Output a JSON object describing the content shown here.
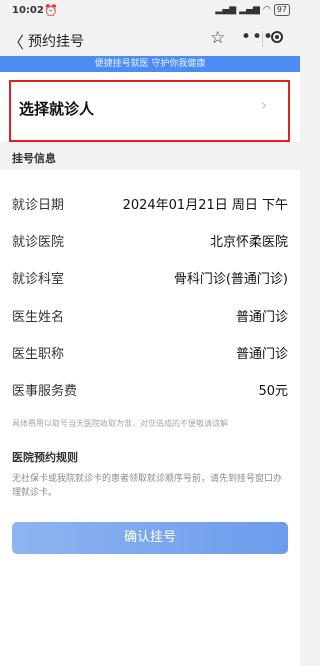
{
  "status_bar": {
    "time": "10:02",
    "alarm_icon": "alarm-clock-icon",
    "battery": "97"
  },
  "nav": {
    "title": "预约挂号",
    "back_icon": "back-arrow-icon",
    "star_icon": "star-icon",
    "more_icon": "more-dots-icon",
    "record_icon": "record-icon"
  },
  "banner": {
    "text": "便捷挂号就医 守护你我健康"
  },
  "patient": {
    "label": "选择就诊人",
    "chevron": "›"
  },
  "registration": {
    "section_title": "挂号信息",
    "rows": [
      {
        "key": "就诊日期",
        "value": "2024年01月21日 周日 下午"
      },
      {
        "key": "就诊医院",
        "value": "北京怀柔医院"
      },
      {
        "key": "就诊科室",
        "value": "骨科门诊(普通门诊)"
      },
      {
        "key": "医生姓名",
        "value": "普通门诊"
      },
      {
        "key": "医生职称",
        "value": "普通门诊"
      },
      {
        "key": "医事服务费",
        "value": "50元"
      }
    ],
    "fee_note": "具体费用以取号当天医院收取为准，对您造成的不便敬请谅解"
  },
  "rules": {
    "title": "医院预约规则",
    "text": "无社保卡或我院就诊卡的患者领取就诊顺序号前，请先到挂号窗口办理就诊卡。"
  },
  "confirm": {
    "label": "确认挂号"
  }
}
